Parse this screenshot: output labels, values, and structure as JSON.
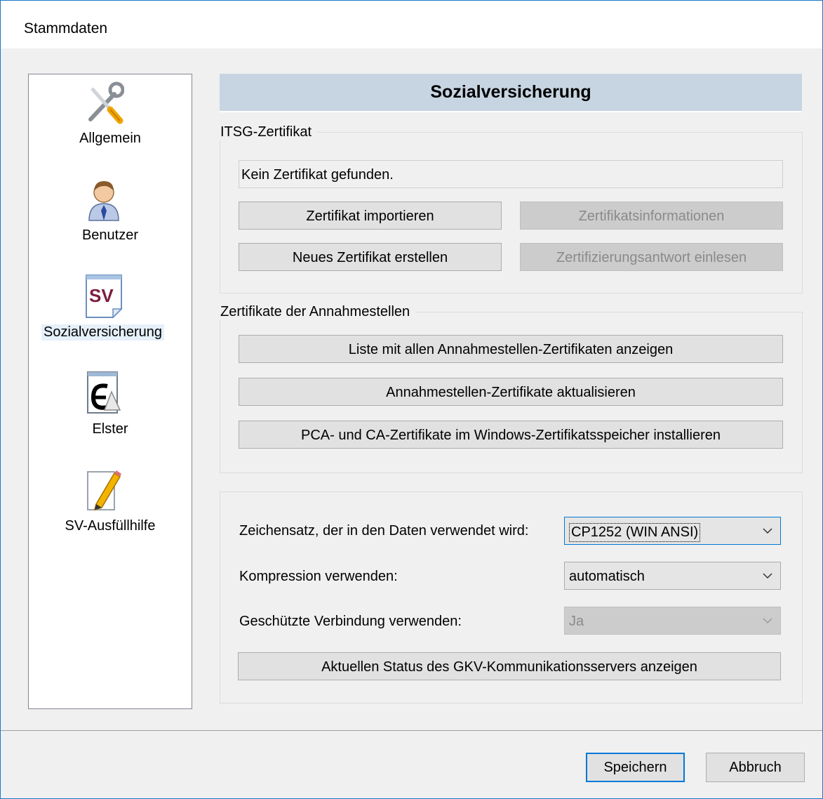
{
  "window": {
    "title": "Stammdaten"
  },
  "sidebar": {
    "items": [
      {
        "label": "Allgemein",
        "icon": "tools-icon"
      },
      {
        "label": "Benutzer",
        "icon": "user-icon"
      },
      {
        "label": "Sozialversicherung",
        "icon": "sv-document-icon",
        "icon_text": "SV",
        "selected": true
      },
      {
        "label": "Elster",
        "icon": "elster-icon"
      },
      {
        "label": "SV-Ausfüllhilfe",
        "icon": "pencil-document-icon"
      }
    ]
  },
  "panel": {
    "title": "Sozialversicherung",
    "itsg": {
      "group_label": "ITSG-Zertifikat",
      "status_text": "Kein Zertifikat gefunden.",
      "import_button": "Zertifikat importieren",
      "info_button": "Zertifikatsinformationen",
      "new_button": "Neues Zertifikat erstellen",
      "response_button": "Zertifizierungsantwort einlesen"
    },
    "annahmestellen": {
      "group_label": "Zertifikate der Annahmestellen",
      "list_button": "Liste mit allen Annahmestellen-Zertifikaten anzeigen",
      "update_button": "Annahmestellen-Zertifikate aktualisieren",
      "install_button": "PCA- und CA-Zertifikate im Windows-Zertifikatsspeicher installieren"
    },
    "settings": {
      "charset_label": "Zeichensatz, der in den Daten verwendet wird:",
      "charset_value": "CP1252 (WIN ANSI)",
      "compression_label": "Kompression verwenden:",
      "compression_value": "automatisch",
      "secure_label": "Geschützte Verbindung verwenden:",
      "secure_value": "Ja",
      "status_button": "Aktuellen Status des GKV-Kommunikationsservers anzeigen"
    }
  },
  "footer": {
    "save_button": "Speichern",
    "cancel_button": "Abbruch"
  },
  "colors": {
    "accent": "#0078d7",
    "header_bg": "#c7d5e2",
    "sv_icon_text": "#7a1f3d"
  }
}
